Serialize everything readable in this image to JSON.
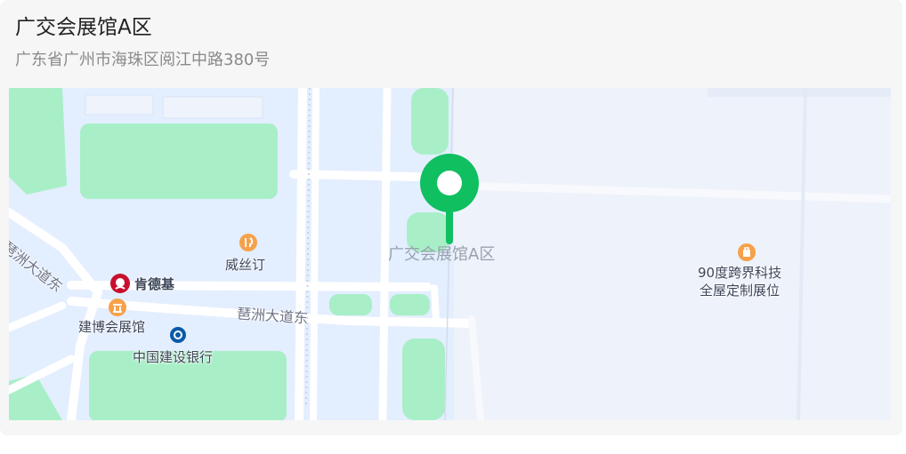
{
  "location": {
    "name": "广交会展馆A区",
    "address": "广东省广州市海珠区阅江中路380号"
  },
  "map": {
    "marker_label": "广交会展馆A区",
    "marker_color": "#0fbf60",
    "pois": [
      {
        "label": "威丝订",
        "icon": "pin-food-icon"
      },
      {
        "label": "肯德基",
        "icon": "kfc-icon"
      },
      {
        "label": "建博会展馆",
        "icon": "landmark-icon"
      },
      {
        "label": "中国建设银行",
        "icon": "bank-icon"
      },
      {
        "label": "90度跨界科技",
        "label2": "全屋定制展位",
        "icon": "shop-icon"
      }
    ],
    "roads": [
      {
        "label": "琶洲大道东"
      },
      {
        "label": "琶洲大道东"
      }
    ],
    "colors": {
      "water_area": "#e3eeff",
      "land": "#eef2fa",
      "green": "#a8efc7",
      "road": "#ffffff",
      "poi_orange": "#f7a14a"
    }
  }
}
